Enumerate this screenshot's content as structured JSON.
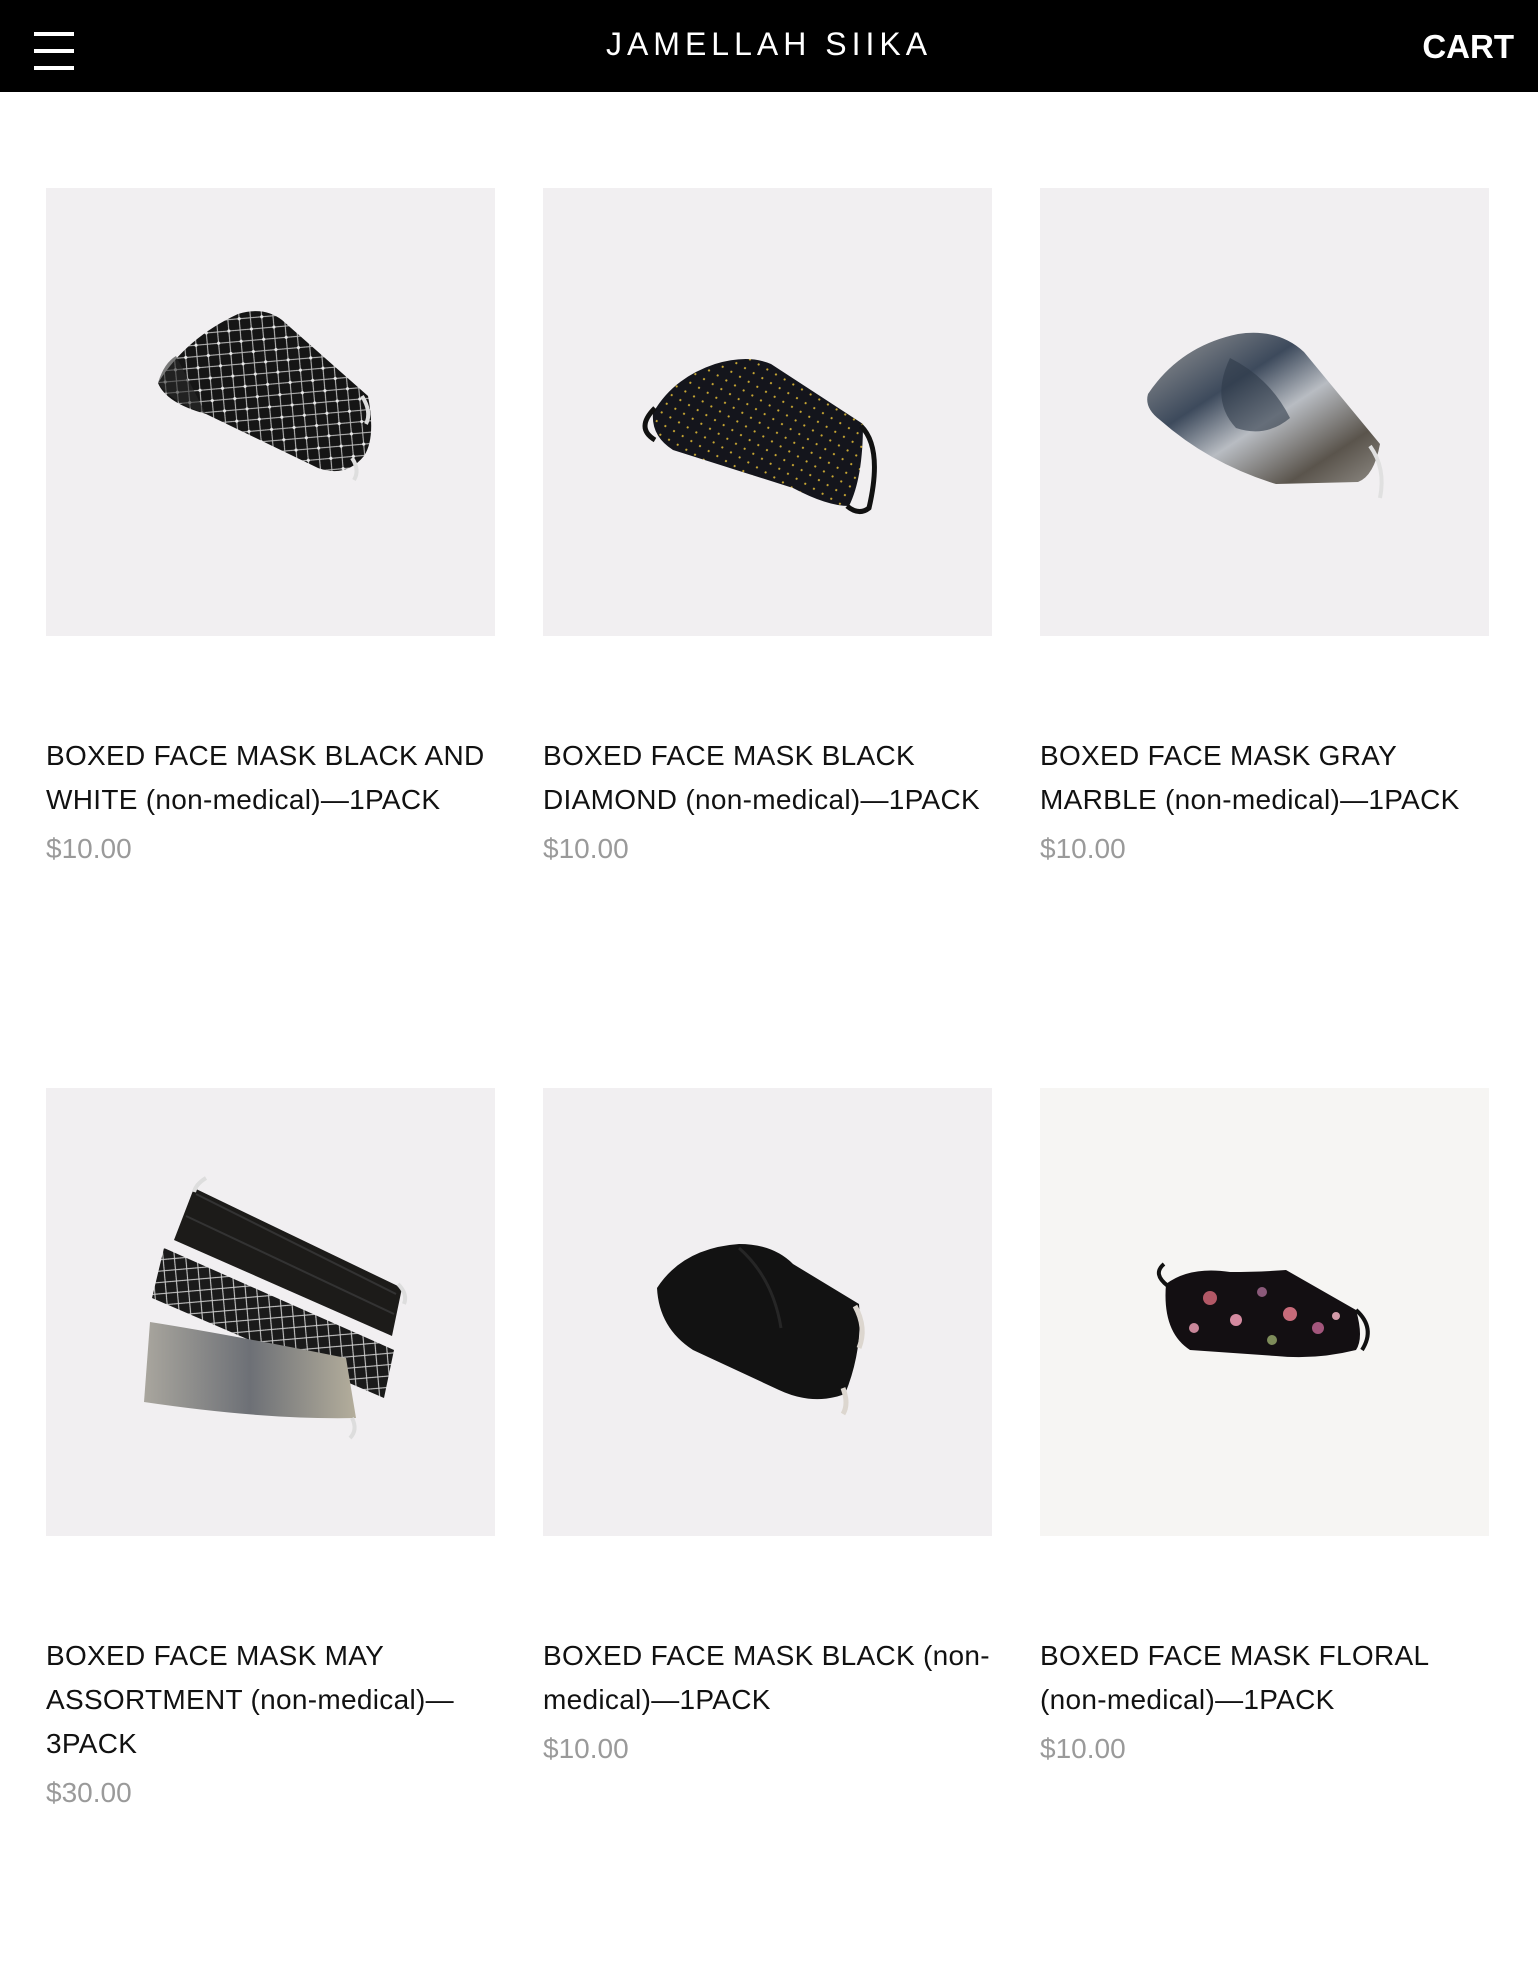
{
  "header": {
    "brand": "JAMELLAH SIIKA",
    "cart_label": "CART"
  },
  "products": [
    {
      "title": "BOXED FACE MASK BLACK AND WHITE (non-medical)—1PACK",
      "price": "$10.00"
    },
    {
      "title": "BOXED FACE MASK BLACK DIAMOND (non-medical)—1PACK",
      "price": "$10.00"
    },
    {
      "title": "BOXED FACE MASK GRAY MARBLE (non-medical)—1PACK",
      "price": "$10.00"
    },
    {
      "title": "BOXED FACE MASK MAY ASSORTMENT (non-medical)—3PACK",
      "price": "$30.00"
    },
    {
      "title": "BOXED FACE MASK BLACK (non-medical)—1PACK",
      "price": "$10.00"
    },
    {
      "title": "BOXED FACE MASK FLORAL (non-medical)—1PACK",
      "price": "$10.00"
    }
  ],
  "colors": {
    "header_bg": "#000000",
    "image_bg": "#f1eff1",
    "price": "#9a9a9a"
  }
}
